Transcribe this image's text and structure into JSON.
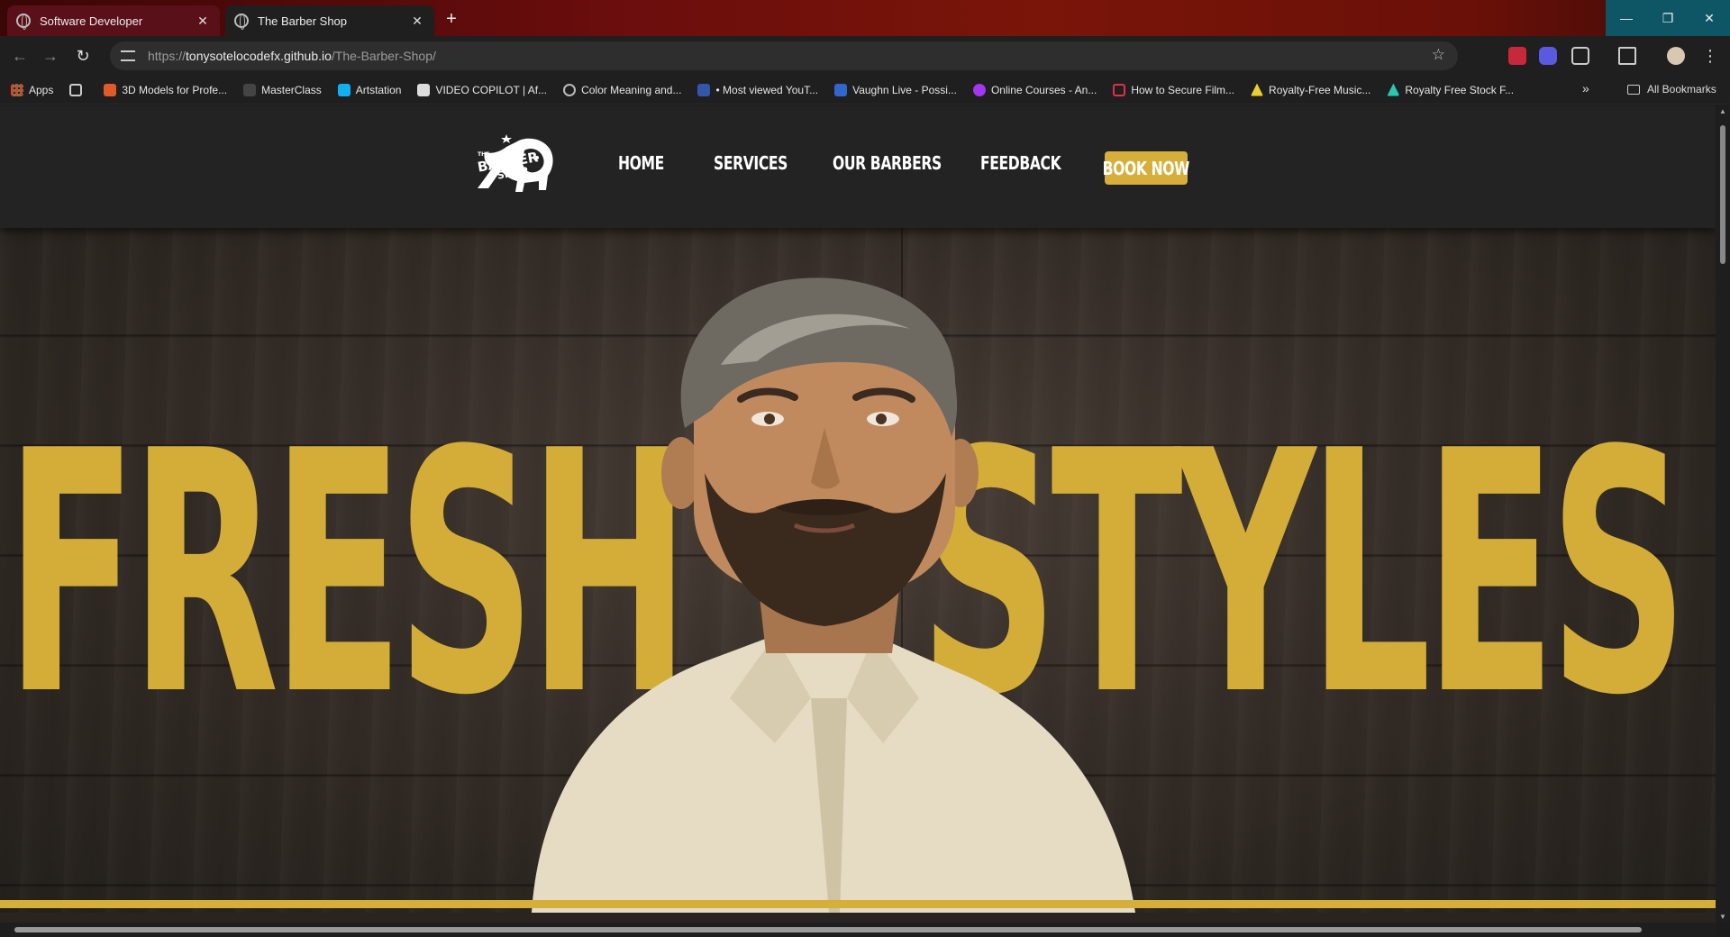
{
  "browser": {
    "tabs": [
      {
        "title": "Software Developer",
        "active": false
      },
      {
        "title": "The Barber Shop",
        "active": true
      }
    ],
    "url_prefix": "https://",
    "url_host": "tonysotelocodefx.github.io",
    "url_path": "/The-Barber-Shop/",
    "bookmarks": [
      {
        "label": "Apps",
        "icon": "apps-grid-icon",
        "color": "#e0a030"
      },
      {
        "label": "",
        "icon": "grid-icon",
        "color": "#cccccc"
      },
      {
        "label": "3D Models for Profe...",
        "icon": "turbosquid-icon",
        "color": "#e05a2a"
      },
      {
        "label": "MasterClass",
        "icon": "masterclass-icon",
        "color": "#dddddd"
      },
      {
        "label": "Artstation",
        "icon": "artstation-icon",
        "color": "#13aff0"
      },
      {
        "label": "VIDEO COPILOT | Af...",
        "icon": "videocopilot-icon",
        "color": "#eeeeee"
      },
      {
        "label": "Color Meaning and...",
        "icon": "globe-icon",
        "color": "#bbbbbb"
      },
      {
        "label": "• Most viewed YouT...",
        "icon": "image-icon",
        "color": "#3355aa"
      },
      {
        "label": "Vaughn Live - Possi...",
        "icon": "vaughn-icon",
        "color": "#3366cc"
      },
      {
        "label": "Online Courses - An...",
        "icon": "udemy-icon",
        "color": "#a435f0"
      },
      {
        "label": "How to Secure Film...",
        "icon": "chat-icon",
        "color": "#e0304a"
      },
      {
        "label": "Royalty-Free Music...",
        "icon": "triangle-icon",
        "color": "#e8d030"
      },
      {
        "label": "Royalty Free Stock F...",
        "icon": "triangle-icon",
        "color": "#2ac8b0"
      }
    ],
    "all_bookmarks": "All Bookmarks"
  },
  "site": {
    "logo_text_top": "THE",
    "logo_text_mid": "BARBER",
    "logo_text_bottom": "SHOP",
    "nav": [
      {
        "label": "HOME"
      },
      {
        "label": "SERVICES"
      },
      {
        "label": "OUR BARBERS"
      },
      {
        "label": "FEEDBACK"
      }
    ],
    "book_label": "BOOK NOW",
    "hero_word_left": "FRESH",
    "hero_word_right": "STYLES"
  },
  "colors": {
    "accent_gold": "#d6ae3a",
    "header_bg": "#232323"
  }
}
